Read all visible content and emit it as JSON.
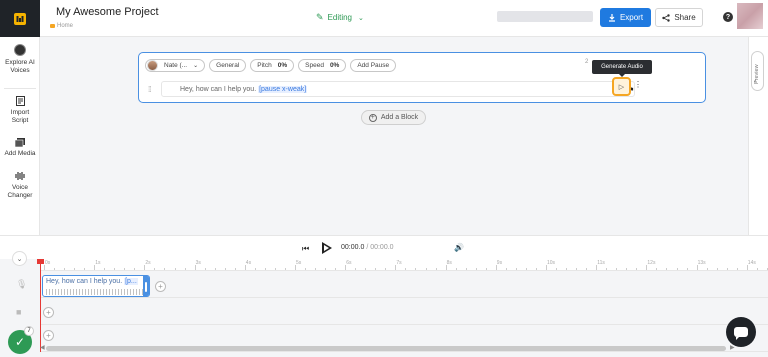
{
  "header": {
    "project_title": "My Awesome Project",
    "breadcrumb": "Home",
    "mode": "Editing",
    "export_label": "Export",
    "share_label": "Share",
    "help_label": "?"
  },
  "sidebar": {
    "items": [
      {
        "label_line1": "Explore AI",
        "label_line2": "Voices"
      },
      {
        "label_line1": "Import",
        "label_line2": "Script"
      },
      {
        "label_line1": "Add Media",
        "label_line2": ""
      },
      {
        "label_line1": "Voice",
        "label_line2": "Changer"
      }
    ]
  },
  "block": {
    "speaker": "Nate (...",
    "style": "General",
    "pitch_label": "Pitch",
    "pitch_value": "0%",
    "speed_label": "Speed",
    "speed_value": "0%",
    "add_pause_label": "Add Pause",
    "text": "Hey, how can I help you.",
    "pause_tag": "[pause x-weak]",
    "counter_hint": "2",
    "tooltip": "Generate Audio"
  },
  "add_block_label": "Add a Block",
  "preview_label": "Preview",
  "player": {
    "current_time": "00:00.0",
    "total_time": "/ 00:00.0"
  },
  "timeline": {
    "ticks": [
      "0s",
      "1s",
      "2s",
      "3s",
      "4s",
      "5s",
      "6s",
      "7s",
      "8s",
      "9s",
      "10s",
      "11s",
      "12s",
      "13s",
      "14s"
    ],
    "clip_text": "Hey, how can I help you.",
    "clip_tag": "[p..."
  },
  "status": {
    "badge": "7"
  },
  "colors": {
    "accent": "#1f7ae0",
    "highlight": "#f5a623",
    "success": "#2e9a55",
    "playhead": "#e53935"
  }
}
